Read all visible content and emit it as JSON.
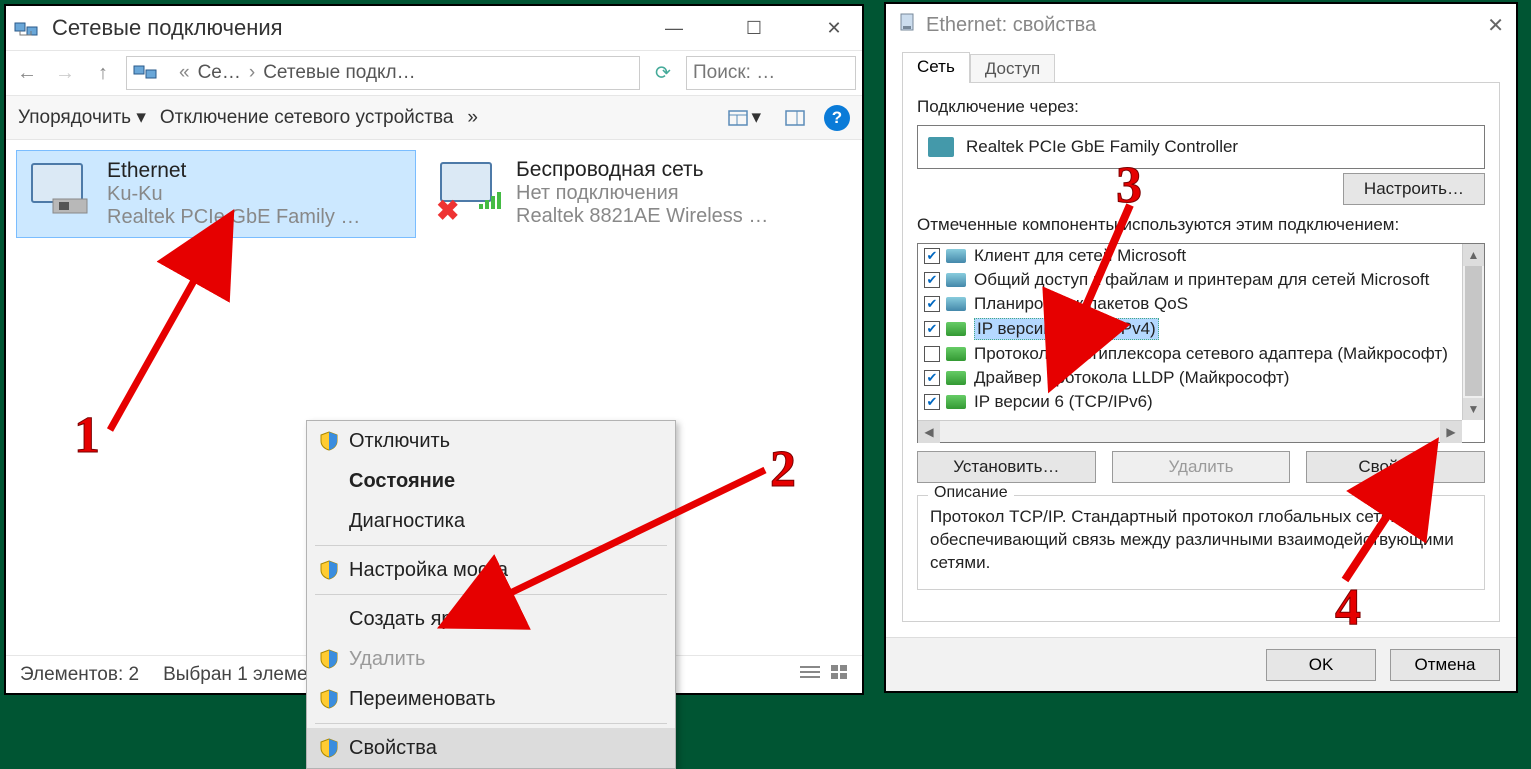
{
  "left": {
    "title": "Сетевые подключения",
    "breadcrumb_prefix": "«",
    "breadcrumb_short": "Се…",
    "breadcrumb_full": "Сетевые подкл…",
    "search_placeholder": "Поиск: …",
    "toolbar": {
      "organize": "Упорядочить ▾",
      "disable": "Отключение сетевого устройства",
      "chevrons": "»"
    },
    "net_items": [
      {
        "name": "Ethernet",
        "line2": "Ku-Ku",
        "line3": "Realtek PCIe GbE Family …",
        "selected": true,
        "wireless": false
      },
      {
        "name": "Беспроводная сеть",
        "line2": "Нет подключения",
        "line3": "Realtek 8821AE Wireless …",
        "selected": false,
        "wireless": true
      }
    ],
    "context_menu": [
      {
        "label": "Отключить",
        "shield": true
      },
      {
        "label": "Состояние",
        "bold": true
      },
      {
        "label": "Диагностика"
      },
      {
        "sep": true
      },
      {
        "label": "Настройка моста",
        "shield": true
      },
      {
        "sep": true
      },
      {
        "label": "Создать ярлык"
      },
      {
        "label": "Удалить",
        "shield": true,
        "disabled": true
      },
      {
        "label": "Переименовать",
        "shield": true
      },
      {
        "sep": true
      },
      {
        "label": "Свойства",
        "shield": true,
        "highlight": true
      }
    ],
    "status": {
      "count": "Элементов: 2",
      "selected": "Выбран 1 элемент"
    }
  },
  "right": {
    "title": "Ethernet: свойства",
    "tabs": [
      "Сеть",
      "Доступ"
    ],
    "connect_via_label": "Подключение через:",
    "adapter": "Realtek PCIe GbE Family Controller",
    "configure_btn": "Настроить…",
    "components_label": "Отмеченные компоненты используются этим подключением:",
    "components": [
      {
        "checked": true,
        "icon": "blue",
        "label": "Клиент для сетей Microsoft"
      },
      {
        "checked": true,
        "icon": "blue",
        "label": "Общий доступ к файлам и принтерам для сетей Microsoft"
      },
      {
        "checked": true,
        "icon": "blue",
        "label": "Планировщик пакетов QoS"
      },
      {
        "checked": true,
        "icon": "green",
        "label": "IP версии 4 (TCP/IPv4)",
        "selected": true
      },
      {
        "checked": false,
        "icon": "green",
        "label": "Протокол мультиплексора сетевого адаптера (Майкрософт)"
      },
      {
        "checked": true,
        "icon": "green",
        "label": "Драйвер протокола LLDP (Майкрософт)"
      },
      {
        "checked": true,
        "icon": "green",
        "label": "IP версии 6 (TCP/IPv6)"
      }
    ],
    "buttons": {
      "install": "Установить…",
      "remove": "Удалить",
      "props": "Свойства"
    },
    "desc_label": "Описание",
    "desc_text": "Протокол TCP/IP. Стандартный протокол глобальных сетей, обеспечивающий связь между различными взаимодействующими сетями.",
    "ok": "OK",
    "cancel": "Отмена"
  },
  "annotations": {
    "n1": "1",
    "n2": "2",
    "n3": "3",
    "n4": "4"
  }
}
